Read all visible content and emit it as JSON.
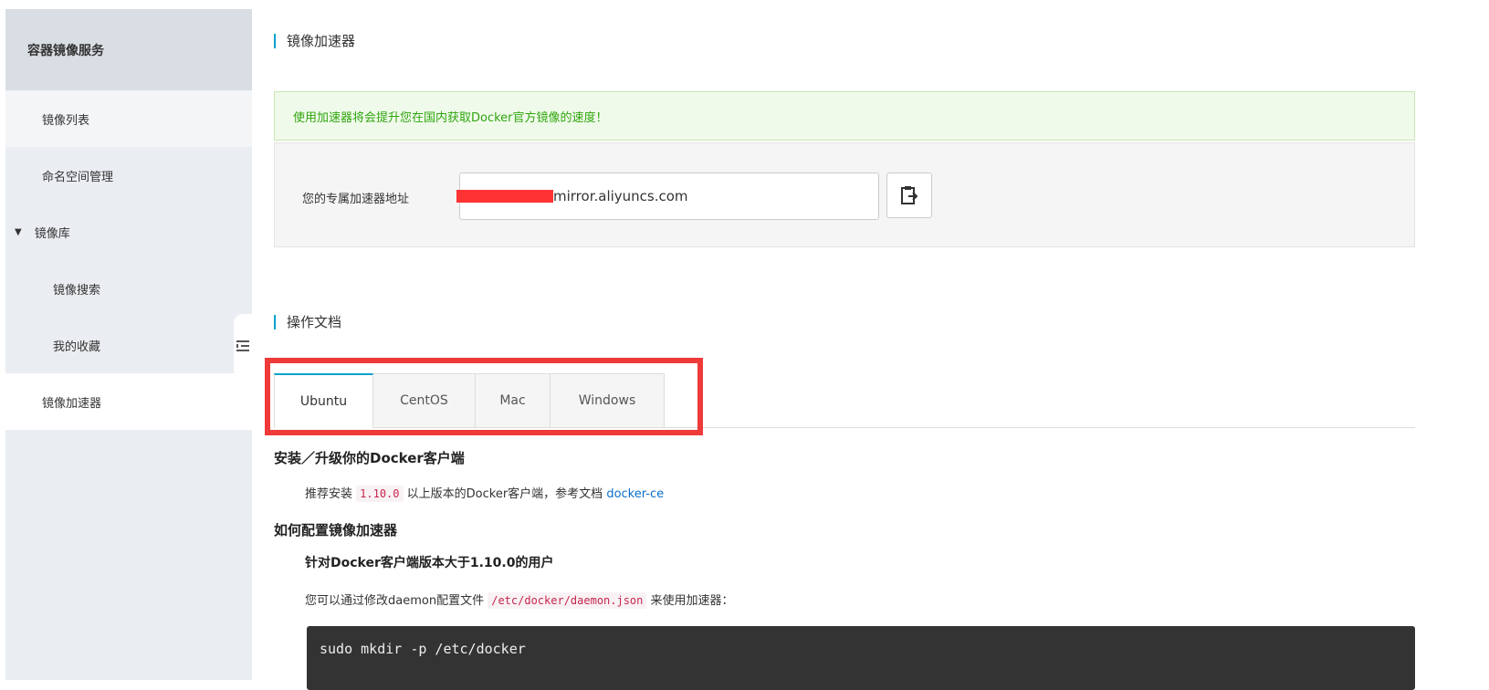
{
  "sidebar": {
    "header": "容器镜像服务",
    "items": [
      {
        "label": "镜像列表"
      },
      {
        "label": "命名空间管理"
      },
      {
        "label": "镜像库"
      },
      {
        "label": "镜像搜索"
      },
      {
        "label": "我的收藏"
      },
      {
        "label": "镜像加速器"
      }
    ]
  },
  "accelerator": {
    "section_title": "镜像加速器",
    "notice": "使用加速器将会提升您在国内获取Docker官方镜像的速度！",
    "address_label": "您的专属加速器地址",
    "address_value": "mirror.aliyuncs.com"
  },
  "docs": {
    "section_title": "操作文档",
    "tabs": [
      "Ubuntu",
      "CentOS",
      "Mac",
      "Windows"
    ],
    "install_heading": "安装／升级你的Docker客户端",
    "install_prefix": "推荐安装",
    "install_version": "1.10.0",
    "install_suffix": "以上版本的Docker客户端，参考文档",
    "install_link": "docker-ce",
    "config_heading": "如何配置镜像加速器",
    "config_subheading": "针对Docker客户端版本大于1.10.0的用户",
    "config_prefix": "您可以通过修改daemon配置文件",
    "config_path": "/etc/docker/daemon.json",
    "config_suffix": "来使用加速器：",
    "code_first_line": "sudo mkdir -p /etc/docker"
  },
  "colors": {
    "accent": "#00a2ca",
    "notice_text": "#2fa60d",
    "highlight": "#ef3a3a"
  }
}
